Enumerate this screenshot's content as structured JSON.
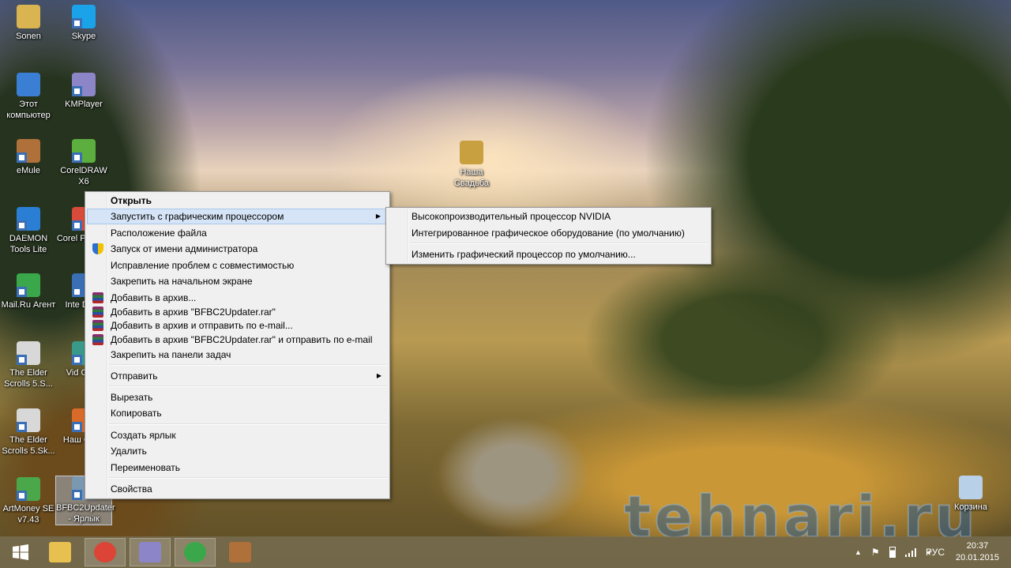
{
  "desktop_icons": [
    {
      "label": "Sonen",
      "color": "#d9b450"
    },
    {
      "label": "Skype",
      "color": "#1aa3e8"
    },
    {
      "label": "Этот компьютер",
      "color": "#3b7fd4"
    },
    {
      "label": "KMPlayer",
      "color": "#8c86c8"
    },
    {
      "label": "eMule",
      "color": "#b0703a"
    },
    {
      "label": "CorelDRAW X6",
      "color": "#5cae3e"
    },
    {
      "label": "DAEMON Tools Lite",
      "color": "#2a7fd4"
    },
    {
      "label": "Corel PHOTO",
      "color": "#d84a3a"
    },
    {
      "label": "Mail.Ru Агент",
      "color": "#3aa84a"
    },
    {
      "label": "Inte Drive",
      "color": "#3a6fb5"
    },
    {
      "label": "The Elder Scrolls 5.S...",
      "color": "#d8d8d8"
    },
    {
      "label": "Vid Conv",
      "color": "#3a9a8a"
    },
    {
      "label": "The Elder Scrolls 5.Sk...",
      "color": "#d8d8d8"
    },
    {
      "label": "Наш Свад",
      "color": "#d86a2a"
    },
    {
      "label": "ArtMoney SE v7.43",
      "color": "#4aa84a"
    },
    {
      "label": "BFBC2Updater - Ярлык",
      "color": "#7a98b0"
    },
    {
      "label": "Наша Свадьба",
      "color": "#c9a040"
    },
    {
      "label": "Корзина",
      "color": "#b8d0e8"
    }
  ],
  "context_menu": {
    "items": [
      {
        "label": "Открыть",
        "bold": true
      },
      {
        "label": "Запустить с графическим процессором",
        "submenu": true,
        "highlighted": true
      },
      {
        "label": "Расположение файла"
      },
      {
        "label": "Запуск от имени администратора",
        "icon": "shield-icon"
      },
      {
        "label": "Исправление проблем с совместимостью"
      },
      {
        "label": "Закрепить на начальном экране"
      },
      {
        "label": "Добавить в архив...",
        "icon": "winrar-icon"
      },
      {
        "label": "Добавить в архив \"BFBC2Updater.rar\"",
        "icon": "winrar-icon"
      },
      {
        "label": "Добавить в архив и отправить по e-mail...",
        "icon": "winrar-icon"
      },
      {
        "label": "Добавить в архив \"BFBC2Updater.rar\" и отправить по e-mail",
        "icon": "winrar-icon"
      },
      {
        "label": "Закрепить на панели задач"
      },
      {
        "label": "Отправить",
        "submenu": true
      },
      {
        "label": "Вырезать"
      },
      {
        "label": "Копировать"
      },
      {
        "label": "Создать ярлык"
      },
      {
        "label": "Удалить"
      },
      {
        "label": "Переименовать"
      },
      {
        "label": "Свойства"
      }
    ]
  },
  "submenu": {
    "items": [
      {
        "label": "Высокопроизводительный процессор NVIDIA"
      },
      {
        "label": "Интегрированное графическое оборудование (по умолчанию)"
      },
      {
        "label": "Изменить графический процессор по умолчанию..."
      }
    ]
  },
  "watermark": "tehnari.ru",
  "taskbar": {
    "apps": [
      "file-explorer-icon",
      "chrome-icon",
      "kmplayer-icon",
      "mailru-agent-icon",
      "emule-icon"
    ],
    "tray": {
      "language": "РУС",
      "time": "20:37",
      "date": "20.01.2015"
    }
  }
}
